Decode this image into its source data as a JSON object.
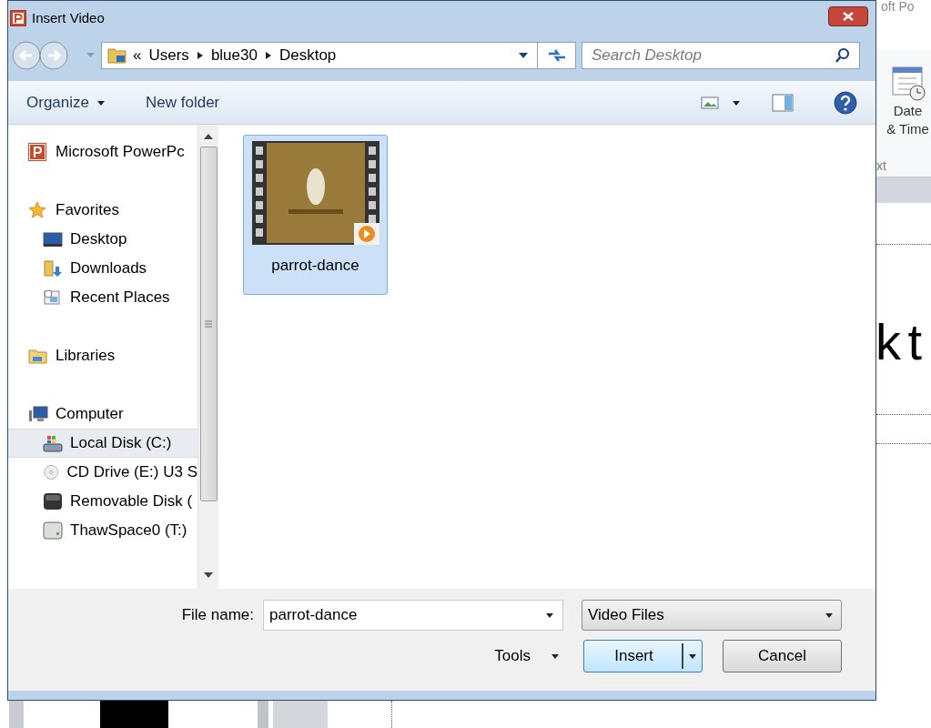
{
  "background_app": {
    "title_fragment": "oft Po",
    "ribbon_button": "Date & Time",
    "ribbon_group": "xt",
    "slide_text": "k t"
  },
  "window": {
    "title": "Insert Video"
  },
  "address_bar": {
    "breadcrumbs": [
      "«",
      "Users",
      "blue30",
      "Desktop"
    ]
  },
  "search": {
    "placeholder": "Search Desktop"
  },
  "toolbar": {
    "buttons": [
      "Organize",
      "New folder"
    ]
  },
  "sidebar": {
    "items": [
      {
        "label": "Microsoft PowerPc",
        "selected": false
      },
      {
        "label": "Favorites",
        "selected": false,
        "children": [
          {
            "label": "Desktop",
            "selected": false
          },
          {
            "label": "Downloads",
            "selected": false
          },
          {
            "label": "Recent Places",
            "selected": false
          }
        ]
      },
      {
        "label": "Libraries",
        "selected": false
      },
      {
        "label": "Computer",
        "selected": false,
        "children": [
          {
            "label": "Local Disk (C:)",
            "selected": true
          },
          {
            "label": "CD Drive (E:) U3 S",
            "selected": false
          },
          {
            "label": "Removable Disk (",
            "selected": false
          },
          {
            "label": "ThawSpace0 (T:)",
            "selected": false
          }
        ]
      }
    ]
  },
  "files": [
    {
      "name": "parrot-dance",
      "selected": true
    }
  ],
  "file_name": {
    "label": "File name:",
    "value": "parrot-dance"
  },
  "file_type": {
    "value": "Video Files"
  },
  "buttons": {
    "tools": "Tools",
    "insert": "Insert",
    "cancel": "Cancel"
  }
}
